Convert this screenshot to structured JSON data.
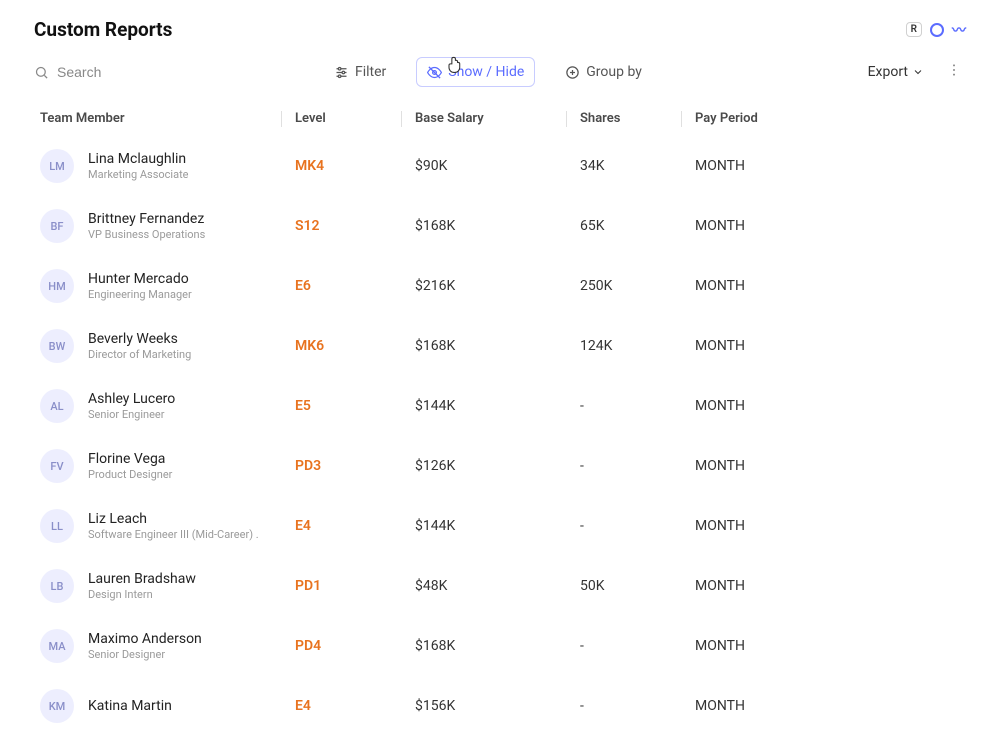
{
  "header": {
    "title": "Custom Reports",
    "badge": "R"
  },
  "toolbar": {
    "search_placeholder": "Search",
    "filter_label": "Filter",
    "show_hide_label": "Show / Hide",
    "group_by_label": "Group by",
    "export_label": "Export"
  },
  "table": {
    "columns": [
      "Team Member",
      "Level",
      "Base Salary",
      "Shares",
      "Pay Period"
    ],
    "rows": [
      {
        "initials": "LM",
        "name": "Lina Mclaughlin",
        "title": "Marketing Associate",
        "level": "MK4",
        "salary": "$90K",
        "shares": "34K",
        "period": "MONTH"
      },
      {
        "initials": "BF",
        "name": "Brittney Fernandez",
        "title": "VP Business Operations",
        "level": "S12",
        "salary": "$168K",
        "shares": "65K",
        "period": "MONTH"
      },
      {
        "initials": "HM",
        "name": "Hunter Mercado",
        "title": "Engineering Manager",
        "level": "E6",
        "salary": "$216K",
        "shares": "250K",
        "period": "MONTH"
      },
      {
        "initials": "BW",
        "name": "Beverly Weeks",
        "title": "Director of Marketing",
        "level": "MK6",
        "salary": "$168K",
        "shares": "124K",
        "period": "MONTH"
      },
      {
        "initials": "AL",
        "name": "Ashley Lucero",
        "title": "Senior Engineer",
        "level": "E5",
        "salary": "$144K",
        "shares": "-",
        "period": "MONTH"
      },
      {
        "initials": "FV",
        "name": "Florine Vega",
        "title": "Product Designer",
        "level": "PD3",
        "salary": "$126K",
        "shares": "-",
        "period": "MONTH"
      },
      {
        "initials": "LL",
        "name": "Liz Leach",
        "title": "Software Engineer III (Mid-Career) .",
        "level": "E4",
        "salary": "$144K",
        "shares": "-",
        "period": "MONTH"
      },
      {
        "initials": "LB",
        "name": "Lauren Bradshaw",
        "title": "Design Intern",
        "level": "PD1",
        "salary": "$48K",
        "shares": "50K",
        "period": "MONTH"
      },
      {
        "initials": "MA",
        "name": "Maximo Anderson",
        "title": "Senior Designer",
        "level": "PD4",
        "salary": "$168K",
        "shares": "-",
        "period": "MONTH"
      },
      {
        "initials": "KM",
        "name": "Katina Martin",
        "title": "",
        "level": "E4",
        "salary": "$156K",
        "shares": "-",
        "period": "MONTH"
      }
    ]
  }
}
